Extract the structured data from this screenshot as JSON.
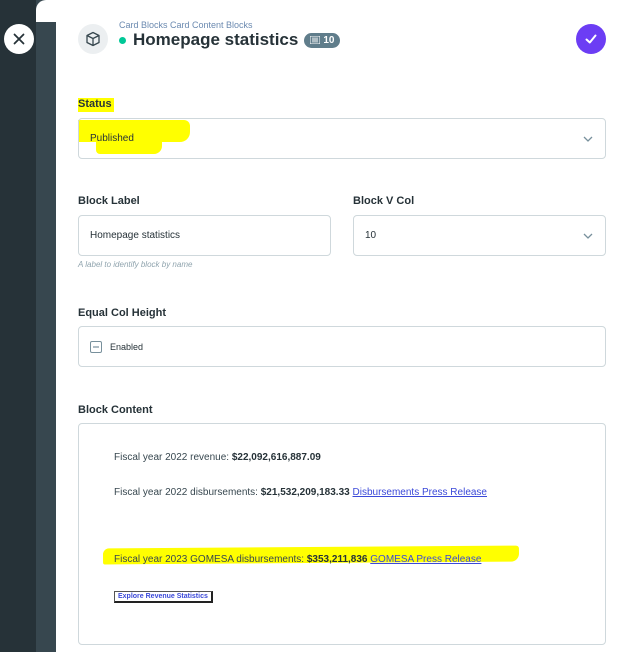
{
  "header": {
    "breadcrumb": "Card Blocks Card Content Blocks",
    "title": "Homepage statistics",
    "badge_count": "10"
  },
  "form": {
    "status": {
      "label": "Status",
      "value": "Published"
    },
    "block_label": {
      "label": "Block Label",
      "value": "Homepage statistics",
      "hint": "A label to identify block by name"
    },
    "block_v_col": {
      "label": "Block V Col",
      "value": "10"
    },
    "equal_col_height": {
      "label": "Equal Col Height",
      "value": "Enabled"
    },
    "block_content": {
      "label": "Block Content",
      "line1_text": "Fiscal year 2022 revenue: ",
      "line1_value": "$22,092,616,887.09",
      "line2_text": "Fiscal year 2022 disbursements: ",
      "line2_value": "$21,532,209,183.33",
      "line2_link": "Disbursements Press Release",
      "line3_text": "Fiscal year 2023 GOMESA disbursements: ",
      "line3_value": "$353,211,836",
      "line3_link": "GOMESA Press Release",
      "button_label": "Explore Revenue Statistics"
    }
  },
  "colors": {
    "accent": "#6c3df4",
    "status_dot": "#00c897",
    "highlight": "#ffff00",
    "sidebar": "#263238",
    "link": "#3b49d9"
  }
}
